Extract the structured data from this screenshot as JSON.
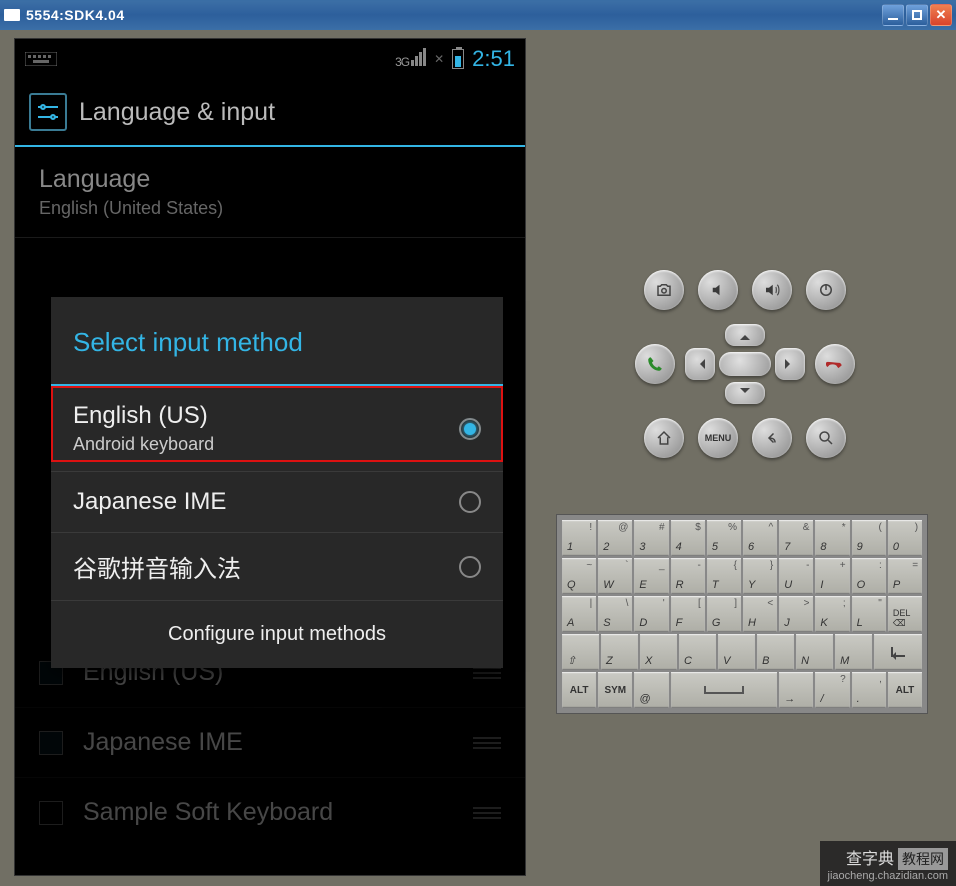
{
  "titlebar": {
    "title": "5554:SDK4.04"
  },
  "status": {
    "net": "3G",
    "time": "2:51"
  },
  "header": {
    "title": "Language & input"
  },
  "settings": {
    "language": {
      "label": "Language",
      "value": "English (United States)"
    },
    "dim1": {
      "label": "English (US)"
    },
    "dim2": {
      "label": "Japanese IME"
    },
    "dim3": {
      "label": "Sample Soft Keyboard"
    }
  },
  "dialog": {
    "title": "Select input method",
    "opt1": {
      "title": "English (US)",
      "sub": "Android keyboard"
    },
    "opt2": {
      "title": "Japanese IME"
    },
    "opt3": {
      "title": "谷歌拼音输入法"
    },
    "button": "Configure input methods"
  },
  "ctrls": {
    "menu": "MENU"
  },
  "keys": {
    "r1": [
      [
        "1",
        "!"
      ],
      [
        "2",
        "@"
      ],
      [
        "3",
        "#"
      ],
      [
        "4",
        "$"
      ],
      [
        "5",
        "%"
      ],
      [
        "6",
        "^"
      ],
      [
        "7",
        "&"
      ],
      [
        "8",
        "*"
      ],
      [
        "9",
        "("
      ],
      [
        "0",
        ")"
      ]
    ],
    "r2": [
      [
        "Q",
        "~"
      ],
      [
        "W",
        "`"
      ],
      [
        "E",
        "_"
      ],
      [
        "R",
        "-"
      ],
      [
        "T",
        "{"
      ],
      [
        "Y",
        "}"
      ],
      [
        "U",
        "-"
      ],
      [
        "I",
        "+"
      ],
      [
        "O",
        ":"
      ],
      [
        "P",
        "="
      ]
    ],
    "r3": [
      [
        "A",
        "|"
      ],
      [
        "S",
        "\\"
      ],
      [
        "D",
        "'"
      ],
      [
        "F",
        "["
      ],
      [
        "G",
        "]"
      ],
      [
        "H",
        "<"
      ],
      [
        "J",
        ">"
      ],
      [
        "K",
        ";"
      ],
      [
        "L",
        "\""
      ]
    ],
    "r3del": "DEL",
    "r4": [
      [
        "Z",
        ""
      ],
      [
        "X",
        ""
      ],
      [
        "C",
        ""
      ],
      [
        "V",
        ""
      ],
      [
        "B",
        ""
      ],
      [
        "N",
        ""
      ],
      [
        "M",
        ""
      ]
    ],
    "r4shift": "⇧",
    "r4enter": "",
    "r5alt": "ALT",
    "r5sym": "SYM",
    "r5at": "@",
    "r5comma": ",",
    "r5period": ".",
    "r5slash": "/",
    "r5q": "?"
  },
  "watermark": {
    "main": "查字典",
    "tag": "教程网",
    "url": "jiaocheng.chazidian.com"
  }
}
